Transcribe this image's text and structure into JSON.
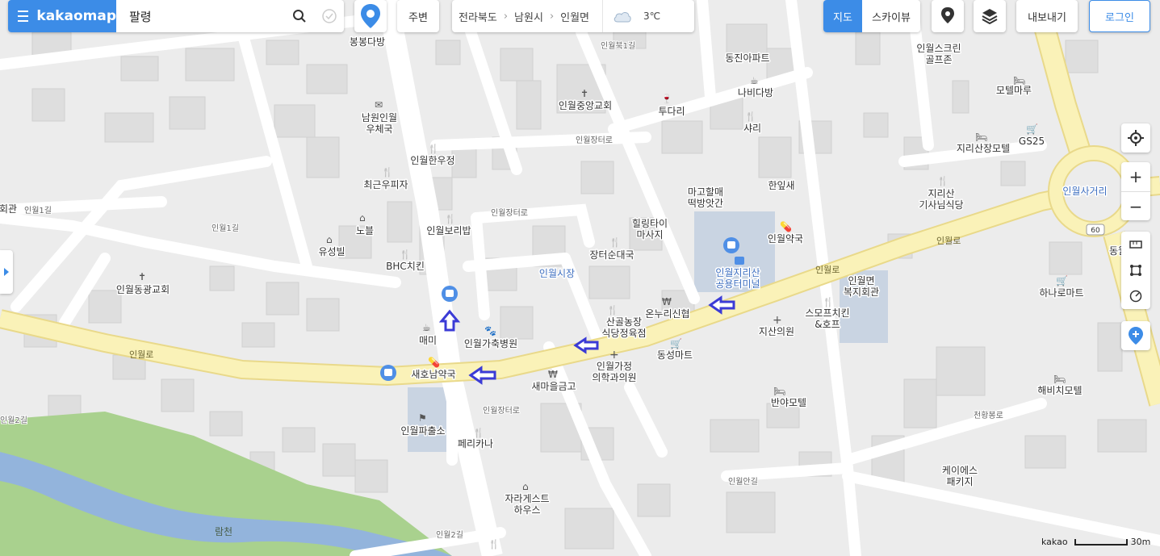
{
  "search": {
    "brand": "kakaomap",
    "query": "팔령"
  },
  "toolbar": {
    "nearby_label": "주변",
    "breadcrumb": [
      "전라북도",
      "남원시",
      "인월면"
    ],
    "weather_temp": "3℃",
    "map_type_active": "지도",
    "map_type_other": "스카이뷰",
    "export_label": "내보내기",
    "login_label": "로그인"
  },
  "zoom": {
    "in": "+",
    "out": "−"
  },
  "scale": {
    "brand": "kakao",
    "distance": "30m"
  },
  "colors": {
    "accent": "#3c8ce7",
    "main_road": "#faf2b8",
    "river": "#93b4dc",
    "park": "#a9d18e",
    "arrow": "#3b3bd6"
  },
  "map": {
    "places": {
      "bongbong": "봉봉다방",
      "post": "남원인월\n우체국",
      "hanujeong": "인월한우정",
      "choigeun": "최근우피자",
      "nobul": "노블",
      "yuseong": "유성빌",
      "bhc": "BHC치킨",
      "boribap": "인월보리밥",
      "dongkwang": "인월동광교회",
      "maemi": "매미",
      "saeho": "새호남약국",
      "hospital": "인월가축병원",
      "police": "인월파출소",
      "ferry": "페리카나",
      "guest": "자라게스트\n하우스",
      "market": "인월시장",
      "church": "인월중앙교회",
      "tudari": "투다리",
      "jangteo": "장터순대국",
      "sangol": "산골농장\n식당정육점",
      "clinic": "인월가정\n의학과의원",
      "bank": "새마을금고",
      "onnuri": "온누리신협",
      "dongseong": "동성마트",
      "banya": "반야모텔",
      "healing": "힐링타이\n마사지",
      "mago": "마고할매\n떡방앗간",
      "terminal": "인월지리산\n공용터미널",
      "hanip": "한잎새",
      "yakguk": "인월약국",
      "shari": "샤리",
      "nabi": "나비다방",
      "dongjin": "동진아파트",
      "jirisan_taxi": "지리산\n기사님식당",
      "somb": "스모프치킨\n&호프",
      "welfare": "인월면\n복지회관",
      "jisan": "지산의원",
      "screen": "인월스크린\n골프존",
      "motelmaru": "모텔마루",
      "jirisanmotel": "지리산장모텔",
      "gs": "GS25",
      "hanaro": "하나로마트",
      "haebichi": "해비치모텔",
      "keis": "케이에스\n패키지",
      "dong_cut": "동월",
      "cut_left": "회관",
      "river": "람천",
      "rotary": "인월사거리",
      "route": "60"
    },
    "roads": {
      "main1": "인월로",
      "main2": "인월로",
      "main3": "인월로",
      "r_1gil_a": "인월1길",
      "r_1gil_b": "인월1길",
      "r_2gil_a": "인월2길",
      "r_2gil_b": "인월2길",
      "r_jangteo_a": "인월장터로",
      "r_jangteo_b": "인월장터로",
      "r_jangteo_c": "인월장터로",
      "r_bukdo": "인월북1길",
      "r_an": "인월안길",
      "r_cheonhwang": "천황봉로"
    }
  }
}
